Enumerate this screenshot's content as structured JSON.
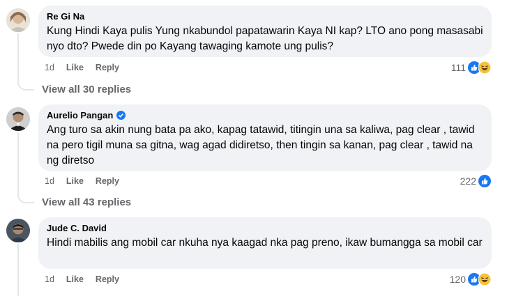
{
  "comments": [
    {
      "name": "Re Gi Na",
      "text": "Kung Hindi Kaya pulis Yung nkabundol papatawarin Kaya NI kap? LTO ano pong masasabi nyo dto? Pwede din po Kayang tawaging kamote ung pulis?",
      "time": "1d",
      "like_label": "Like",
      "reply_label": "Reply",
      "reaction_count": "111",
      "reactions": [
        "like-icon",
        "haha-icon"
      ],
      "view_replies": "View all 30 replies"
    },
    {
      "name": "Aurelio Pangan",
      "verified": true,
      "text": "Ang turo sa akin nung bata pa ako, kapag tatawid, titingin una sa kaliwa, pag clear , tawid na pero tigil muna sa gitna, wag agad didiretso, then tingin sa kanan, pag clear , tawid na ng diretso",
      "time": "1d",
      "like_label": "Like",
      "reply_label": "Reply",
      "reaction_count": "222",
      "reactions": [
        "like-icon"
      ],
      "view_replies": "View all 43 replies"
    },
    {
      "name": "Jude C. David",
      "text": "Hindi mabilis ang mobil car nkuha nya kaagad nka pag preno, ikaw bumangga sa mobil car",
      "time": "1d",
      "like_label": "Like",
      "reply_label": "Reply",
      "reaction_count": "120",
      "reactions": [
        "like-icon",
        "haha-icon"
      ]
    }
  ],
  "colors": {
    "like_blue": "#1877f2",
    "haha_yellow": "#f7c23a",
    "bubble_bg": "#f0f2f5",
    "secondary_text": "#65676b"
  }
}
